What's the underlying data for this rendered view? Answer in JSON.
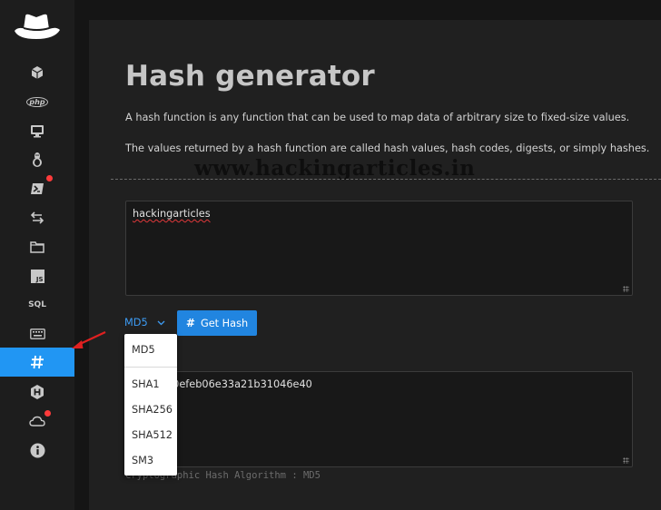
{
  "sidebar": {
    "items": [
      {
        "icon": "cube-icon"
      },
      {
        "icon": "php-icon",
        "label": "php"
      },
      {
        "icon": "monitor-icon"
      },
      {
        "icon": "linux-icon"
      },
      {
        "icon": "powershell-icon",
        "badge": true
      },
      {
        "icon": "swap-arrows-icon"
      },
      {
        "icon": "folder-icon"
      },
      {
        "icon": "js-icon",
        "label": "JS"
      },
      {
        "icon": "sql-icon",
        "label": "SQL"
      },
      {
        "icon": "keyboard-icon"
      },
      {
        "icon": "hash-icon",
        "active": true
      },
      {
        "icon": "hackthebox-icon"
      },
      {
        "icon": "cloud-icon",
        "badge": true
      },
      {
        "icon": "info-icon"
      }
    ]
  },
  "page": {
    "title": "Hash generator",
    "description_1": "A hash function is any function that can be used to map data of arbitrary size to fixed-size values.",
    "description_2": "The values returned by a hash function are called hash values, hash codes, digests, or simply hashes.",
    "watermark": "www.hackingarticles.in"
  },
  "form": {
    "input_value": "hackingarticles",
    "algorithm_selected": "MD5",
    "get_hash_label": "Get Hash",
    "output_value": "6f0efeb06e33a21b31046e40",
    "algorithm_note": "Cryptographic Hash Algorithm : MD5"
  },
  "dropdown": {
    "options": [
      "MD5",
      "SHA1",
      "SHA256",
      "SHA512",
      "SM3"
    ]
  },
  "colors": {
    "accent": "#2196f3",
    "badge": "#ff3b3b",
    "annotation_arrow": "#e02020"
  }
}
